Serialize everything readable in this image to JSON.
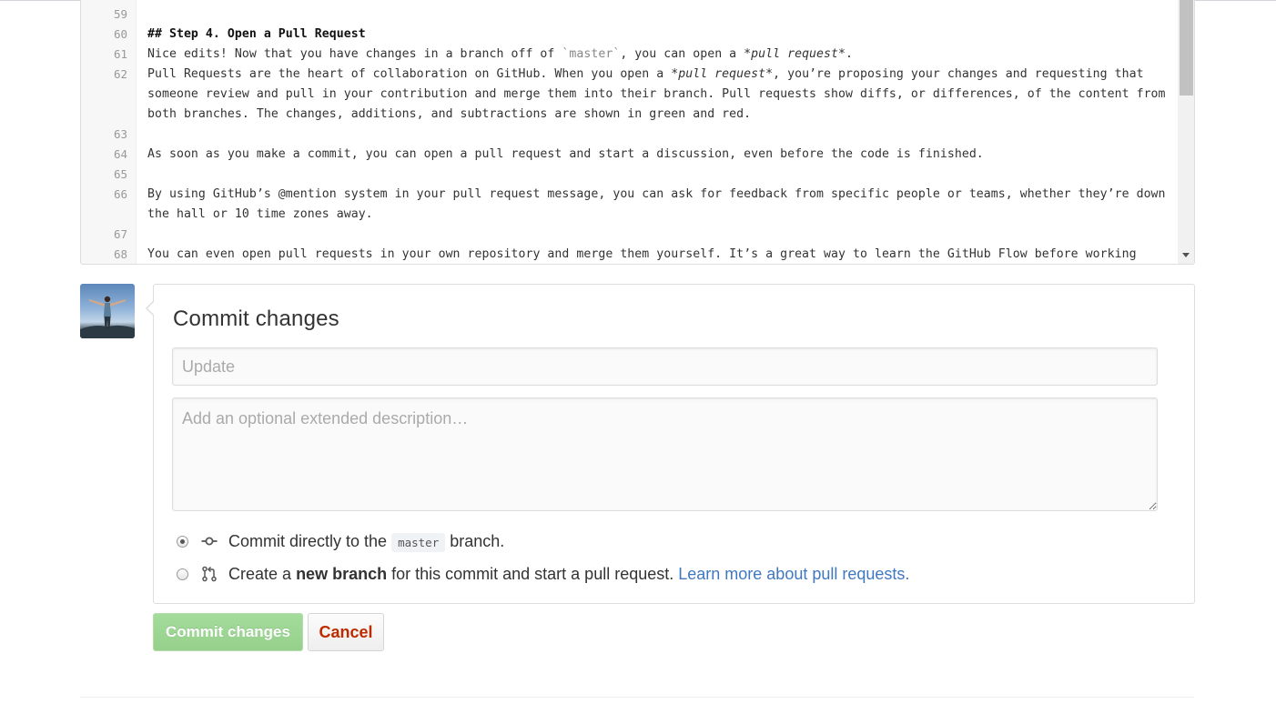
{
  "editor": {
    "lines": [
      {
        "n": "59",
        "text": ""
      },
      {
        "n": "60",
        "text": "## Step 4. Open a Pull Request"
      },
      {
        "n": "61",
        "text_a": "Nice edits! Now that you have changes in a branch off of ",
        "tick": "`master`",
        "text_b": ", you can open a ",
        "ital": "*pull request*",
        "text_c": "."
      },
      {
        "n": "62",
        "text_a": "Pull Requests are the heart of collaboration on GitHub. When you open a ",
        "ital": "*pull request*",
        "text_b": ", you’re proposing your changes and requesting that someone review and pull in your contribution and merge them into their branch. Pull requests show diffs, or differences, of the content from both branches. The changes, additions, and subtractions are shown in green and red."
      },
      {
        "n": "63",
        "text": ""
      },
      {
        "n": "64",
        "text": "As soon as you make a commit, you can open a pull request and start a discussion, even before the code is finished."
      },
      {
        "n": "65",
        "text": ""
      },
      {
        "n": "66",
        "text": "By using GitHub’s @mention system in your pull request message, you can ask for feedback from specific people or teams, whether they’re down the hall or 10 time zones away."
      },
      {
        "n": "67",
        "text": ""
      },
      {
        "n": "68",
        "text": "You can even open pull requests in your own repository and merge them yourself. It’s a great way to learn the GitHub Flow before working"
      }
    ]
  },
  "commit": {
    "title": "Commit changes",
    "summary_placeholder": "Update",
    "summary_value": "",
    "description_placeholder": "Add an optional extended description…",
    "option_direct": {
      "prefix": "Commit directly to the",
      "branch": "master",
      "suffix": "branch."
    },
    "option_new": {
      "prefix": "Create a",
      "bold": "new branch",
      "suffix": "for this commit and start a pull request.",
      "link": "Learn more about pull requests."
    },
    "selected": "direct",
    "submit_label": "Commit changes",
    "cancel_label": "Cancel"
  },
  "colors": {
    "submit_bg": "#a4dd9b",
    "cancel_text": "#bd2c00",
    "link": "#4078c0"
  },
  "icons": {
    "commit": "git-commit-icon",
    "branch": "git-pull-request-icon",
    "scroll_down": "triangle-down-icon"
  }
}
